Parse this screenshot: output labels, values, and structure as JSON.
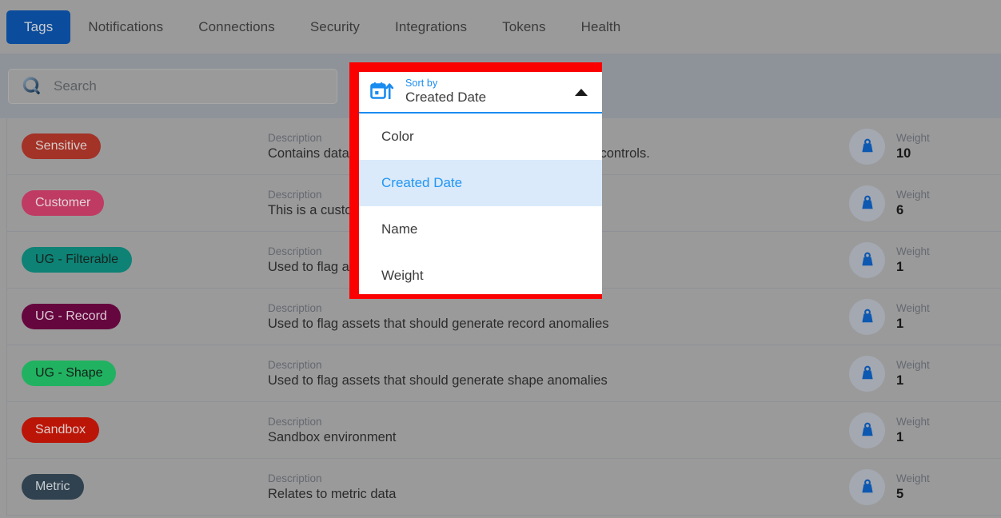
{
  "tabs": [
    {
      "label": "Tags",
      "active": true
    },
    {
      "label": "Notifications",
      "active": false
    },
    {
      "label": "Connections",
      "active": false
    },
    {
      "label": "Security",
      "active": false
    },
    {
      "label": "Integrations",
      "active": false
    },
    {
      "label": "Tokens",
      "active": false
    },
    {
      "label": "Health",
      "active": false
    }
  ],
  "toolbar": {
    "search": {
      "icon": "search-icon",
      "placeholder": "Search",
      "value": ""
    },
    "sort": {
      "icon": "calendar-sort-ascending-icon",
      "label": "Sort by",
      "value": "Created Date",
      "expanded": true,
      "caret": "chevron-up-icon",
      "options": [
        {
          "label": "Color",
          "selected": false
        },
        {
          "label": "Created Date",
          "selected": true
        },
        {
          "label": "Name",
          "selected": false
        },
        {
          "label": "Weight",
          "selected": false
        }
      ]
    },
    "filter": {
      "icon": "funnel-icon",
      "caret": "chevron-down-icon",
      "label": ""
    }
  },
  "list": {
    "labels": {
      "description": "Description",
      "weight": "Weight"
    },
    "weight_icon": "weight-icon",
    "rows": [
      {
        "tag": "Sensitive",
        "tag_color": "#a33227",
        "tag_text_color": "#d6ccca",
        "description": "Contains data that is sensitive and requires strict access controls.",
        "weight": "10"
      },
      {
        "tag": "Customer",
        "tag_color": "#bf3b63",
        "tag_text_color": "#e4d3d9",
        "description": "This is a customer tag",
        "weight": "6"
      },
      {
        "tag": "UG - Filterable",
        "tag_color": "#0d8275",
        "tag_text_color": "#16241f",
        "description": "Used to flag assets that are filterable",
        "weight": "1"
      },
      {
        "tag": "UG - Record",
        "tag_color": "#66063f",
        "tag_text_color": "#ddc9d3",
        "description": "Used to flag assets that should generate record anomalies",
        "weight": "1"
      },
      {
        "tag": "UG - Shape",
        "tag_color": "#21b261",
        "tag_text_color": "#122017",
        "description": "Used to flag assets that should generate shape anomalies",
        "weight": "1"
      },
      {
        "tag": "Sandbox",
        "tag_color": "#bb1508",
        "tag_text_color": "#e0cdc9",
        "description": "Sandbox environment",
        "weight": "1"
      },
      {
        "tag": "Metric",
        "tag_color": "#30414f",
        "tag_text_color": "#c7cdd2",
        "description": "Relates to metric data",
        "weight": "5"
      }
    ]
  },
  "colors": {
    "accent_blue": "#1a8cf0",
    "active_tab_blue": "#0c4c9c",
    "highlight_red": "#fb0000",
    "backdrop_gray": "#9a9a9a",
    "toolbar_gray": "#8e9399"
  }
}
